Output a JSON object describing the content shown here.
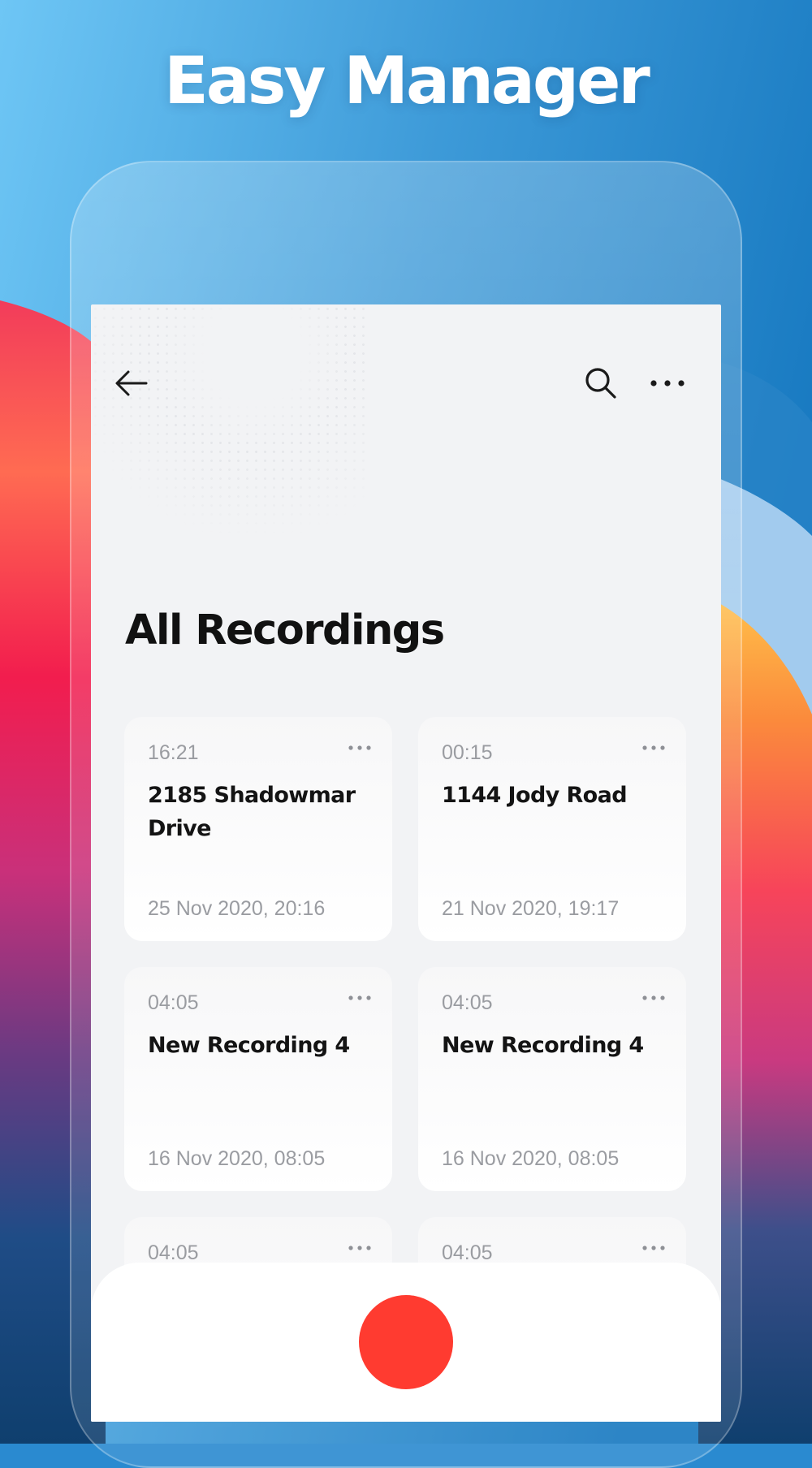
{
  "headline": "Easy Manager",
  "colors": {
    "record": "#ff3b30",
    "screen_bg": "#f2f3f5",
    "card_bg": "#ffffff"
  },
  "nav": {
    "back_icon": "arrow-left-icon",
    "search_icon": "search-icon",
    "more_icon": "more-horizontal-icon"
  },
  "page_title": "All Recordings",
  "recordings": [
    {
      "duration": "16:21",
      "title": "2185  Shadowmar Drive",
      "date": "25 Nov 2020, 20:16"
    },
    {
      "duration": "00:15",
      "title": "1144  Jody Road",
      "date": "21 Nov 2020, 19:17"
    },
    {
      "duration": "04:05",
      "title": "New Recording 4",
      "date": "16 Nov 2020, 08:05"
    },
    {
      "duration": "04:05",
      "title": "New Recording 4",
      "date": "16 Nov 2020, 08:05"
    },
    {
      "duration": "04:05",
      "title": "",
      "date": ""
    },
    {
      "duration": "04:05",
      "title": "",
      "date": ""
    }
  ],
  "record_button_icon": "record-icon"
}
